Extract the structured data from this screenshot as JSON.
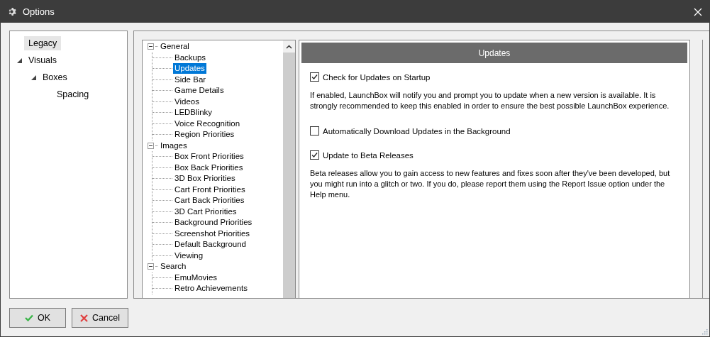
{
  "window": {
    "title": "Options"
  },
  "sidebar": {
    "items": [
      {
        "label": "Legacy",
        "selected": true
      },
      {
        "label": "Visuals",
        "selected": false,
        "expanded": true,
        "children": [
          {
            "label": "Boxes",
            "selected": false,
            "expanded": true,
            "children": [
              {
                "label": "Spacing",
                "selected": false
              }
            ]
          }
        ]
      }
    ]
  },
  "categories": [
    {
      "label": "General",
      "expanded": true,
      "children": [
        {
          "label": "Backups",
          "selected": false
        },
        {
          "label": "Updates",
          "selected": true
        },
        {
          "label": "Side Bar",
          "selected": false
        },
        {
          "label": "Game Details",
          "selected": false
        },
        {
          "label": "Videos",
          "selected": false
        },
        {
          "label": "LEDBlinky",
          "selected": false
        },
        {
          "label": "Voice Recognition",
          "selected": false
        },
        {
          "label": "Region Priorities",
          "selected": false
        }
      ]
    },
    {
      "label": "Images",
      "expanded": true,
      "children": [
        {
          "label": "Box Front Priorities",
          "selected": false
        },
        {
          "label": "Box Back Priorities",
          "selected": false
        },
        {
          "label": "3D Box Priorities",
          "selected": false
        },
        {
          "label": "Cart Front Priorities",
          "selected": false
        },
        {
          "label": "Cart Back Priorities",
          "selected": false
        },
        {
          "label": "3D Cart Priorities",
          "selected": false
        },
        {
          "label": "Background Priorities",
          "selected": false
        },
        {
          "label": "Screenshot Priorities",
          "selected": false
        },
        {
          "label": "Default Background",
          "selected": false
        },
        {
          "label": "Viewing",
          "selected": false
        }
      ]
    },
    {
      "label": "Search",
      "expanded": true,
      "children": [
        {
          "label": "EmuMovies",
          "selected": false
        },
        {
          "label": "Retro Achievements",
          "selected": false
        }
      ]
    }
  ],
  "panel": {
    "title": "Updates",
    "settings": [
      {
        "label": "Check for Updates on Startup",
        "checked": true,
        "description": "If enabled, LaunchBox will notify you and prompt you to update when a new version is available. It is strongly recommended to keep this enabled in order to ensure the best possible LaunchBox experience."
      },
      {
        "label": "Automatically Download Updates in the Background",
        "checked": false
      },
      {
        "label": "Update to Beta Releases",
        "checked": true,
        "description": "Beta releases allow you to gain access to new features and fixes soon after they've been developed, but you might run into a glitch or two. If you do, please report them using the Report Issue option under the Help menu."
      }
    ]
  },
  "buttons": [
    {
      "label": "OK",
      "kind": "ok"
    },
    {
      "label": "Cancel",
      "kind": "cancel"
    }
  ]
}
